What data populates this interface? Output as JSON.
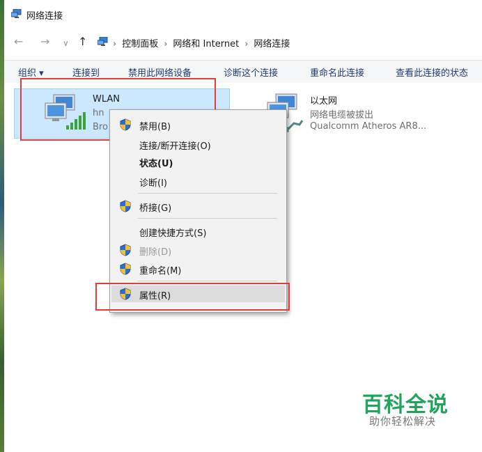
{
  "window": {
    "title": "网络连接"
  },
  "nav": {
    "back": "←",
    "forward": "→",
    "recent": "∨",
    "up": "↑"
  },
  "breadcrumb": {
    "sep": "›",
    "items": [
      "控制面板",
      "网络和 Internet",
      "网络连接"
    ]
  },
  "toolbar": {
    "organize": "组织 ▾",
    "connect_to": "连接到",
    "disable": "禁用此网络设备",
    "diagnose": "诊断这个连接",
    "rename": "重命名此连接",
    "view_status": "查看此连接的状态"
  },
  "connections": {
    "wlan": {
      "name": "WLAN",
      "status": "hn",
      "device": "Bro"
    },
    "ethernet": {
      "name": "以太网",
      "status": "网络电缆被拔出",
      "device": "Qualcomm Atheros AR8..."
    }
  },
  "context_menu": {
    "items": [
      {
        "label": "禁用(B)",
        "icon": "uac-shield-icon"
      },
      {
        "label": "连接/断开连接(O)"
      },
      {
        "label": "状态(U)",
        "bold": true
      },
      {
        "label": "诊断(I)"
      },
      {
        "label": "桥接(G)",
        "icon": "uac-shield-icon"
      },
      {
        "label": "创建快捷方式(S)"
      },
      {
        "label": "删除(D)",
        "icon": "uac-shield-icon",
        "disabled": true
      },
      {
        "label": "重命名(M)",
        "icon": "uac-shield-icon"
      },
      {
        "label": "属性(R)",
        "icon": "uac-shield-icon",
        "highlighted": true
      }
    ]
  },
  "watermark": {
    "title": "百科全说",
    "subtitle": "助你轻松解决"
  },
  "colors": {
    "selection": "#cce8ff",
    "annotation_red": "#e03c3c",
    "watermark_green": "#1fa45a"
  }
}
